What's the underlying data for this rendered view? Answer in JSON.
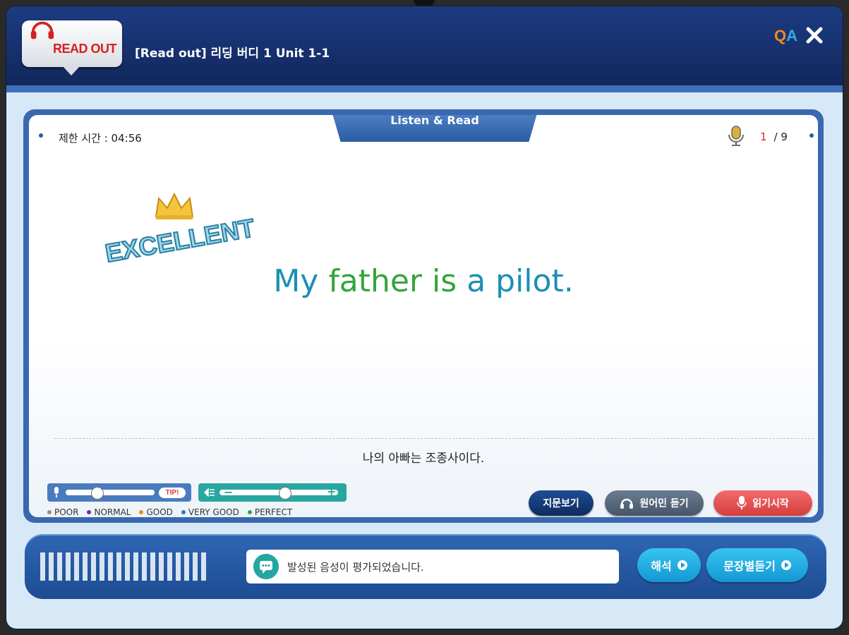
{
  "header": {
    "logo_text": "READ OUT",
    "title": "[Read out] 리딩 버디 1 Unit 1-1",
    "qa_q": "Q",
    "qa_a": "A",
    "qa_icon": "qa-icon",
    "close_icon": "close-icon"
  },
  "panel": {
    "tab_label": "Listen & Read",
    "timer": "제한 시간 : 04:56",
    "page_current": "1",
    "page_total": "/ 9",
    "badge_text": "EXCELLENT",
    "sentence_part1": "My ",
    "sentence_highlight": "father is",
    "sentence_part2": " a pilot.",
    "translation": "나의 아빠는 조종사이다."
  },
  "controls": {
    "mic_level": 0.35,
    "speed_level": 0.55,
    "tip_label": "TIP!",
    "legend": [
      {
        "label": "POOR",
        "color": "#a08a6a"
      },
      {
        "label": "NORMAL",
        "color": "#7a2aa0"
      },
      {
        "label": "GOOD",
        "color": "#f08b1c"
      },
      {
        "label": "VERY GOOD",
        "color": "#2b78d0"
      },
      {
        "label": "PERFECT",
        "color": "#2fa83a"
      }
    ],
    "btn_show_text": "지문보기",
    "btn_native": "원어민 듣기",
    "btn_start_read": "읽기시작"
  },
  "bottom": {
    "message": "발성된 음성이 평가되었습니다.",
    "btn_translate": "해석",
    "btn_sentence_listen": "문장별듣기"
  }
}
